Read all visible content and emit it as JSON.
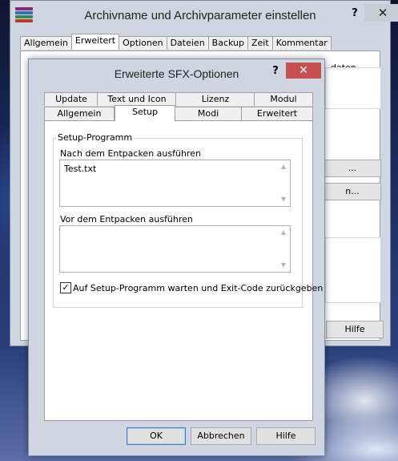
{
  "background": {
    "desktop": "winter-landscape"
  },
  "back_window": {
    "title": "Archivname und Archivparameter einstellen",
    "help_label": "?",
    "close_label": "✕",
    "tabs": [
      "Allgemein",
      "Erweitert",
      "Optionen",
      "Dateien",
      "Backup",
      "Zeit",
      "Kommentar"
    ],
    "active_tab": "Erweitert",
    "partial_text": "daten",
    "partial_buttons": [
      "...",
      "n..."
    ],
    "help_button": "Hilfe"
  },
  "dialog": {
    "title": "Erweiterte SFX-Optionen",
    "help_label": "?",
    "close_label": "✕",
    "tabs_top": [
      "Update",
      "Text und Icon",
      "Lizenz",
      "Modul"
    ],
    "tabs_bottom": [
      "Allgemein",
      "Setup",
      "Modi",
      "Erweitert"
    ],
    "active_tab": "Setup",
    "group_title": "Setup-Programm",
    "after_extract_label": "Nach dem Entpacken ausführen",
    "after_extract_value": "Test.txt",
    "before_extract_label": "Vor dem Entpacken ausführen",
    "before_extract_value": "",
    "wait_checkbox_label": "Auf Setup-Programm warten und Exit-Code zurückgeben",
    "wait_checked": true,
    "ok_label": "OK",
    "cancel_label": "Abbrechen",
    "help_label_button": "Hilfe"
  },
  "colors": {
    "close_red": "#c75050",
    "window_frame": "#cfd6e1",
    "default_button_border": "#3c7fb1"
  }
}
